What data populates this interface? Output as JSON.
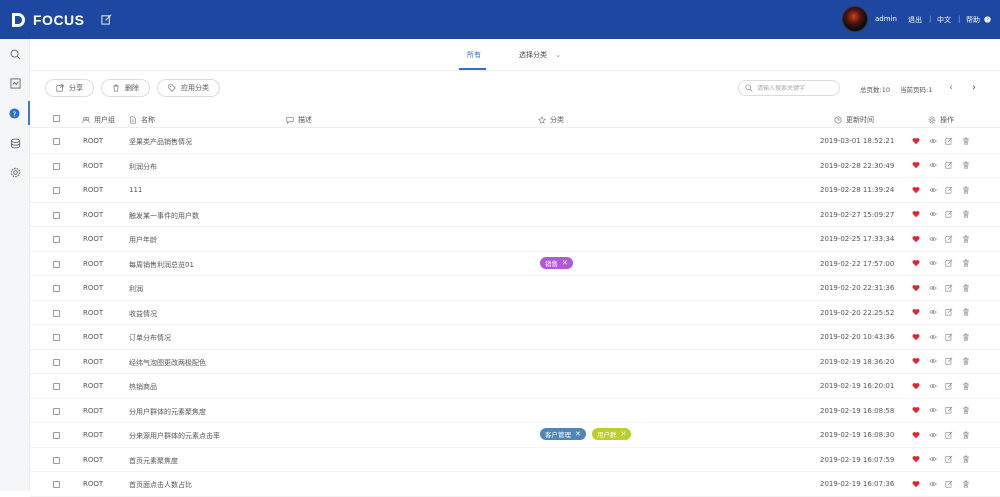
{
  "app": {
    "logo_text": "FOCUS"
  },
  "header": {
    "username": "admin",
    "logout": "退出",
    "language": "中文",
    "help": "帮助"
  },
  "tabs": [
    {
      "label": "所有",
      "active": true
    },
    {
      "label": "选择分类",
      "active": false
    }
  ],
  "toolbar": {
    "share": "分享",
    "delete": "删除",
    "apply_category": "应用分类",
    "search_placeholder": "请输入搜索关键字",
    "total_pages": "总页数:10",
    "current_page": "当前页码:1"
  },
  "table": {
    "headers": {
      "user_group": "用户组",
      "name": "名称",
      "description": "描述",
      "category": "分类",
      "updated": "更新时间",
      "actions": "操作"
    },
    "rows": [
      {
        "group": "ROOT",
        "name": "坚果类产品销售情况",
        "tags": [],
        "time": "2019-03-01 18:52:21"
      },
      {
        "group": "ROOT",
        "name": "利润分布",
        "tags": [],
        "time": "2019-02-28 22:30:49"
      },
      {
        "group": "ROOT",
        "name": "111",
        "tags": [],
        "time": "2019-02-28 11:39:24"
      },
      {
        "group": "ROOT",
        "name": "触发某一事件的用户数",
        "tags": [],
        "time": "2019-02-27 15:09:27"
      },
      {
        "group": "ROOT",
        "name": "用户年龄",
        "tags": [],
        "time": "2019-02-25 17:33:34"
      },
      {
        "group": "ROOT",
        "name": "每周销售利润总览01",
        "tags": [
          {
            "label": "销售",
            "color": "#b05bd3"
          }
        ],
        "time": "2019-02-22 17:57:00"
      },
      {
        "group": "ROOT",
        "name": "利润",
        "tags": [],
        "time": "2019-02-20 22:31:36"
      },
      {
        "group": "ROOT",
        "name": "收益情况",
        "tags": [],
        "time": "2019-02-20 22:25:52"
      },
      {
        "group": "ROOT",
        "name": "订单分布情况",
        "tags": [],
        "time": "2019-02-20 10:43:36"
      },
      {
        "group": "ROOT",
        "name": "经纬气泡图更改两极配色",
        "tags": [],
        "time": "2019-02-19 18:36:20"
      },
      {
        "group": "ROOT",
        "name": "热销商品",
        "tags": [],
        "time": "2019-02-19 16:20:01"
      },
      {
        "group": "ROOT",
        "name": "分用户群体的元素聚焦度",
        "tags": [],
        "time": "2019-02-19 16:08:58"
      },
      {
        "group": "ROOT",
        "name": "分来源用户群体的元素点击率",
        "tags": [
          {
            "label": "客户管理",
            "color": "#4f86b8"
          },
          {
            "label": "用户群",
            "color": "#b9cf2c"
          }
        ],
        "time": "2019-02-19 16:08:30"
      },
      {
        "group": "ROOT",
        "name": "首页元素聚焦度",
        "tags": [],
        "time": "2019-02-19 16:07:59"
      },
      {
        "group": "ROOT",
        "name": "首页面点击人数占比",
        "tags": [],
        "time": "2019-02-19 16:07:36"
      }
    ]
  },
  "colors": {
    "header_bg": "#1d47a0",
    "accent": "#2f6fd1",
    "heart": "#e0262c"
  }
}
